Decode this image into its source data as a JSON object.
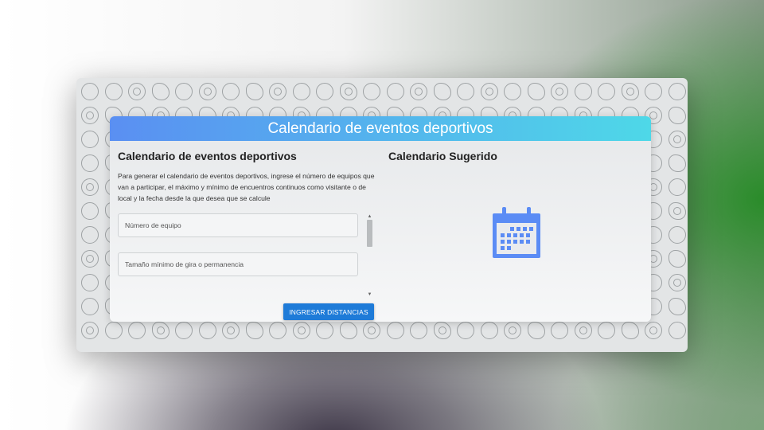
{
  "page": {
    "title": "Calendario de eventos deportivos",
    "accent_color": "#5b8cf5",
    "button_color": "#1e7bd8"
  },
  "left": {
    "section_title": "Calendario de eventos deportivos",
    "description": "Para generar el calendario de eventos deportivos, ingrese el número de equipos que van a participar, el máximo y mínimo de encuentros continuos como visitante o de local y la fecha desde la que desea que se calcule",
    "fields": [
      {
        "placeholder": "Número de equipo"
      },
      {
        "placeholder": "Tamaño mínimo de gira o permanencia"
      }
    ],
    "submit_label": "INGRESAR DISTANCIAS"
  },
  "right": {
    "section_title": "Calendario Sugerido",
    "icon": "calendar-icon"
  }
}
